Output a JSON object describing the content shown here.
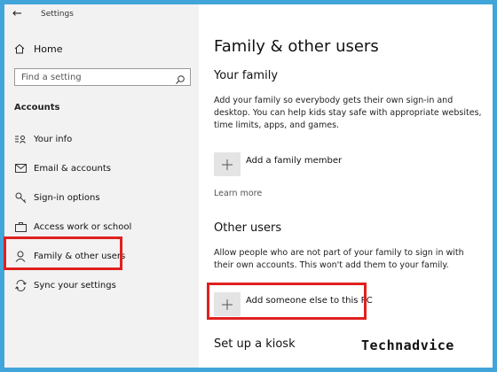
{
  "window": {
    "title": "Settings"
  },
  "sidebar": {
    "home_label": "Home",
    "search_placeholder": "Find a setting",
    "section_label": "Accounts",
    "items": [
      {
        "label": "Your info",
        "icon": "contact-card-icon"
      },
      {
        "label": "Email & accounts",
        "icon": "mail-icon"
      },
      {
        "label": "Sign-in options",
        "icon": "key-icon"
      },
      {
        "label": "Access work or school",
        "icon": "briefcase-icon"
      },
      {
        "label": "Family & other users",
        "icon": "person-icon",
        "selected": true
      },
      {
        "label": "Sync your settings",
        "icon": "sync-icon"
      }
    ]
  },
  "main": {
    "title": "Family & other users",
    "your_family": {
      "heading": "Your family",
      "description": "Add your family so everybody gets their own sign-in and desktop. You can help kids stay safe with appropriate websites, time limits, apps, and games.",
      "add_label": "Add a family member",
      "learn_more": "Learn more"
    },
    "other_users": {
      "heading": "Other users",
      "description": "Allow people who are not part of your family to sign in with their own accounts. This won't add them to your family.",
      "add_label": "Add someone else to this PC"
    },
    "kiosk": {
      "heading": "Set up a kiosk"
    }
  },
  "watermark": "Technadvice",
  "colors": {
    "frame": "#41a5da",
    "highlight": "#e0201f",
    "sidebar_bg": "#f2f2f2"
  }
}
